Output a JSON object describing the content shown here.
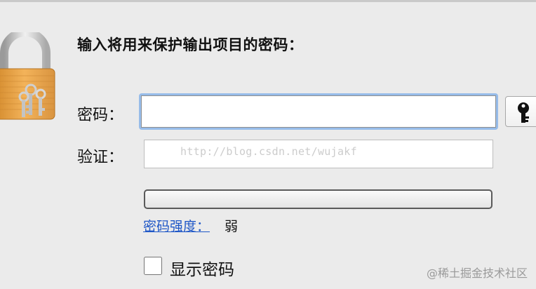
{
  "dialog": {
    "title": "输入将用来保护输出项目的密码：",
    "password_label": "密码：",
    "verify_label": "验证：",
    "password_value": "",
    "verify_value": "",
    "watermark_url": "http://blog.csdn.net/wujakf",
    "strength": {
      "label": "密码强度：",
      "value": "弱",
      "level": 0
    },
    "show_password_label": "显示密码",
    "show_password_checked": false,
    "key_button_icon": "key-icon",
    "lock_icon": "padlock-with-keys-icon"
  },
  "footer": {
    "watermark": "@稀土掘金技术社区"
  },
  "colors": {
    "focus_ring": "#97bce9",
    "link_blue": "#1f57c7",
    "lock_gold": "#e8a54a"
  }
}
